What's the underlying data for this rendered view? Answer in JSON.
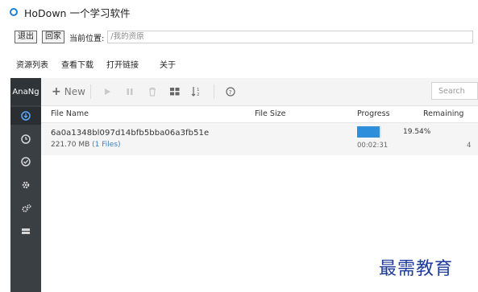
{
  "window": {
    "title": "HoDown 一个学习软件"
  },
  "address_bar": {
    "back_label": "退出",
    "return_label": "回家",
    "location_label": "当前位置:",
    "path_value": "/我的资原"
  },
  "menu": {
    "items": [
      "资源列表",
      "查看下载",
      "打开链接",
      "关于"
    ]
  },
  "sidebar": {
    "brand": "AnaNg",
    "items": [
      {
        "icon": "download-icon",
        "active": true
      },
      {
        "icon": "clock-icon",
        "active": false
      },
      {
        "icon": "check-circle-icon",
        "active": false
      },
      {
        "icon": "gear-icon",
        "active": false
      },
      {
        "icon": "gears-icon",
        "active": false
      },
      {
        "icon": "server-icon",
        "active": false
      }
    ]
  },
  "toolbar": {
    "new_label": "New",
    "search_placeholder": "Search"
  },
  "table": {
    "columns": [
      "File Name",
      "File Size",
      "Progress",
      "Remaining"
    ],
    "rows": [
      {
        "name": "6a0a1348bl097d14bfb5bba06a3fb51e",
        "size": "221.70 MB",
        "files": "(1 Files)",
        "progress_percent": 19.54,
        "progress_text": "19.54%",
        "time": "00:02:31",
        "remaining": "4"
      }
    ]
  },
  "watermark": "最需教育",
  "colors": {
    "sidebar_bg": "#3a3f44",
    "progress_fill": "#2d8fdb",
    "accent": "#1f7fd1"
  }
}
